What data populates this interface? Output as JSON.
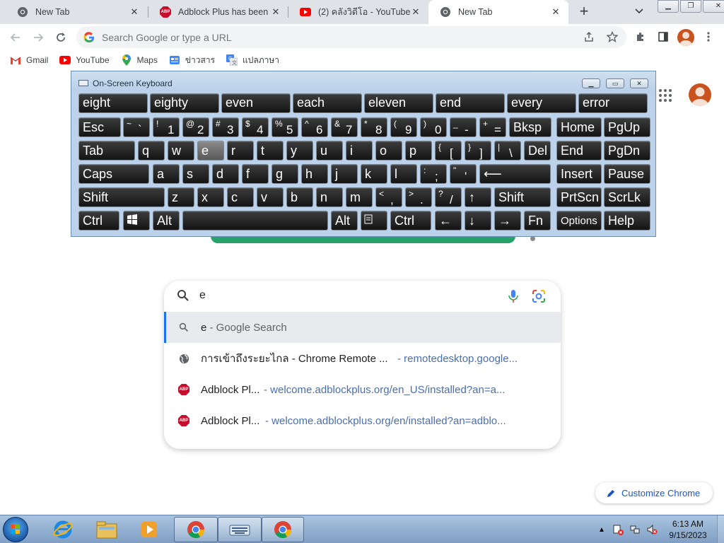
{
  "tabs": [
    {
      "title": "New Tab",
      "icon": "chrome-icon",
      "active": false
    },
    {
      "title": "Adblock Plus has been in",
      "icon": "abp-icon",
      "active": false
    },
    {
      "title": "(2) คลังวิดีโอ - YouTube",
      "icon": "youtube-icon",
      "active": false
    },
    {
      "title": "New Tab",
      "icon": "chrome-icon",
      "active": true
    }
  ],
  "omnibox": {
    "placeholder": "Search Google or type a URL"
  },
  "bookmarks": [
    {
      "label": "Gmail",
      "icon": "gmail-icon"
    },
    {
      "label": "YouTube",
      "icon": "youtube-icon"
    },
    {
      "label": "Maps",
      "icon": "maps-icon"
    },
    {
      "label": "ข่าวสาร",
      "icon": "news-icon"
    },
    {
      "label": "แปลภาษา",
      "icon": "translate-icon"
    }
  ],
  "osk": {
    "title": "On-Screen Keyboard",
    "predictions": [
      "eight",
      "eighty",
      "even",
      "each",
      "eleven",
      "end",
      "every",
      "error"
    ],
    "keys": {
      "esc": "Esc",
      "bksp": "Bksp",
      "home": "Home",
      "pgup": "PgUp",
      "tab": "Tab",
      "del": "Del",
      "end": "End",
      "pgdn": "PgDn",
      "caps": "Caps",
      "insert": "Insert",
      "pause": "Pause",
      "shift": "Shift",
      "prtscn": "PrtScn",
      "scrlk": "ScrLk",
      "ctrl": "Ctrl",
      "alt": "Alt",
      "fn": "Fn",
      "options": "Options",
      "help": "Help",
      "letters_row2": [
        "q",
        "w",
        "e",
        "r",
        "t",
        "y",
        "u",
        "i",
        "o",
        "p"
      ],
      "letters_row3": [
        "a",
        "s",
        "d",
        "f",
        "g",
        "h",
        "j",
        "k",
        "l"
      ],
      "letters_row4": [
        "z",
        "x",
        "c",
        "v",
        "b",
        "n",
        "m"
      ],
      "numbers": [
        {
          "shift": "~",
          "base": "`"
        },
        {
          "shift": "!",
          "base": "1"
        },
        {
          "shift": "@",
          "base": "2"
        },
        {
          "shift": "#",
          "base": "3"
        },
        {
          "shift": "$",
          "base": "4"
        },
        {
          "shift": "%",
          "base": "5"
        },
        {
          "shift": "^",
          "base": "6"
        },
        {
          "shift": "&",
          "base": "7"
        },
        {
          "shift": "*",
          "base": "8"
        },
        {
          "shift": "(",
          "base": "9"
        },
        {
          "shift": ")",
          "base": "0"
        },
        {
          "shift": "_",
          "base": "-"
        },
        {
          "shift": "+",
          "base": "="
        }
      ],
      "brackets": [
        {
          "shift": "{",
          "base": "["
        },
        {
          "shift": "}",
          "base": "]"
        },
        {
          "shift": "|",
          "base": "\\"
        }
      ],
      "semis": [
        {
          "shift": ":",
          "base": ";"
        },
        {
          "shift": "\"",
          "base": "'"
        }
      ],
      "commas": [
        {
          "shift": "<",
          "base": ","
        },
        {
          "shift": ">",
          "base": "."
        },
        {
          "shift": "?",
          "base": "/"
        }
      ],
      "arrows": {
        "up": "↑",
        "left": "←",
        "down": "↓",
        "right": "→"
      },
      "enter": "⟵"
    },
    "pressed_key": "e"
  },
  "search": {
    "query": "e",
    "suggestions": [
      {
        "text": "e",
        "text_suffix": " - Google Search",
        "url": "",
        "icon": "search-icon",
        "selected": true
      },
      {
        "text": "การเข้าถึงระยะไกล - Chrome Remote ...",
        "text_suffix": "",
        "url": "- remotedesktop.google...",
        "icon": "globe-icon",
        "selected": false
      },
      {
        "text": "Adblock Pl...",
        "text_suffix": "",
        "url": "- welcome.adblockplus.org/en_US/installed?an=a...",
        "icon": "abp-icon",
        "selected": false
      },
      {
        "text": "Adblock Pl...",
        "text_suffix": "",
        "url": "- welcome.adblockplus.org/en/installed?an=adblo...",
        "icon": "abp-icon",
        "selected": false
      }
    ]
  },
  "customize": {
    "label": "Customize Chrome"
  },
  "taskbar": {
    "time": "6:13 AM",
    "date": "9/15/2023"
  },
  "colors": {
    "accent": "#1a73e8",
    "green_strip": "#26a36a",
    "abp_red": "#c70d2c"
  }
}
